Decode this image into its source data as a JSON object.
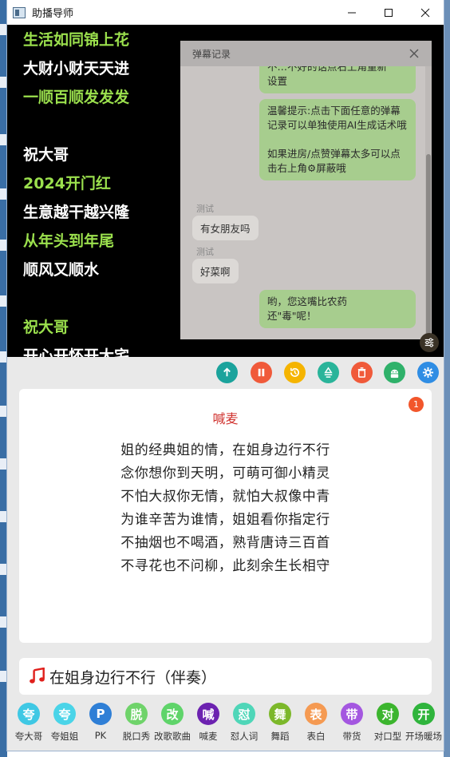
{
  "window": {
    "title": "助播导师"
  },
  "stage_lines": [
    {
      "text": "生活如同锦上花",
      "color": "green"
    },
    {
      "text": "大财小财天天进",
      "color": "white"
    },
    {
      "text": "一顺百顺发发发",
      "color": "green"
    },
    {
      "text": "祝大哥",
      "color": "white"
    },
    {
      "text": "2024开门红",
      "color": "green"
    },
    {
      "text": "生意越干越兴隆",
      "color": "white"
    },
    {
      "text": "从年头到年尾",
      "color": "green"
    },
    {
      "text": "顺风又顺水",
      "color": "white"
    },
    {
      "text": "祝大哥",
      "color": "green"
    },
    {
      "text": "开心开怀开大宅",
      "color": "white"
    }
  ],
  "danmu": {
    "title": "弹幕记录",
    "msg_top": "不…不好的话点右上角重新\n设置",
    "msg_tip": "温馨提示:点击下面任意的弹幕记录可以单独使用AI生成话术哦\n\n如果进房/点赞弹幕太多可以点击右上角⚙屏蔽哦",
    "u1_name": "测试",
    "u1_text": "有女朋友吗",
    "u2_name": "测试",
    "u2_text": "好菜啊",
    "msg_reply": "哟，您这嘴比农药\n还\"毒\"呢！"
  },
  "toolbar": {
    "buttons": [
      {
        "name": "up-icon",
        "color": "#1ba39c"
      },
      {
        "name": "pause-icon",
        "color": "#f05a3a"
      },
      {
        "name": "history-icon",
        "color": "#f5b400"
      },
      {
        "name": "recycle-icon",
        "color": "#2ab49a"
      },
      {
        "name": "trash-icon",
        "color": "#f05a3a"
      },
      {
        "name": "android-icon",
        "color": "#2fb16a"
      },
      {
        "name": "gear-icon",
        "color": "#2f8de4"
      }
    ]
  },
  "card": {
    "title": "喊麦",
    "badge": "1",
    "lines": [
      "姐的经典姐的情，在姐身边行不行",
      "念你想你到天明，可萌可御小精灵",
      "不怕大叔你无情，就怕大叔像中青",
      "为谁辛苦为谁情，姐姐看你指定行",
      "不抽烟也不喝酒，熟背唐诗三百首",
      "不寻花也不问柳，此刻余生长相守"
    ]
  },
  "song": {
    "name": "在姐身边行不行（伴奏）",
    "icon": "music-note-icon"
  },
  "categories": [
    {
      "glyph": "夸",
      "label": "夸大哥",
      "color": "#3fc8e4"
    },
    {
      "glyph": "夸",
      "label": "夸姐姐",
      "color": "#4ad4e8"
    },
    {
      "glyph": "P",
      "label": "PK",
      "color": "#2f7fd6"
    },
    {
      "glyph": "脱",
      "label": "脱口秀",
      "color": "#6fd36a"
    },
    {
      "glyph": "改",
      "label": "改歌歌曲",
      "color": "#5fd46a"
    },
    {
      "glyph": "喊",
      "label": "喊麦",
      "color": "#6c22b0"
    },
    {
      "glyph": "怼",
      "label": "怼人词",
      "color": "#4fd6b8"
    },
    {
      "glyph": "舞",
      "label": "舞蹈",
      "color": "#7cb82a"
    },
    {
      "glyph": "表",
      "label": "表白",
      "color": "#f59a52"
    },
    {
      "glyph": "带",
      "label": "带货",
      "color": "#a457e0"
    },
    {
      "glyph": "对",
      "label": "对口型",
      "color": "#3cb52e"
    },
    {
      "glyph": "开",
      "label": "开场暖场",
      "color": "#2fb43c"
    }
  ]
}
